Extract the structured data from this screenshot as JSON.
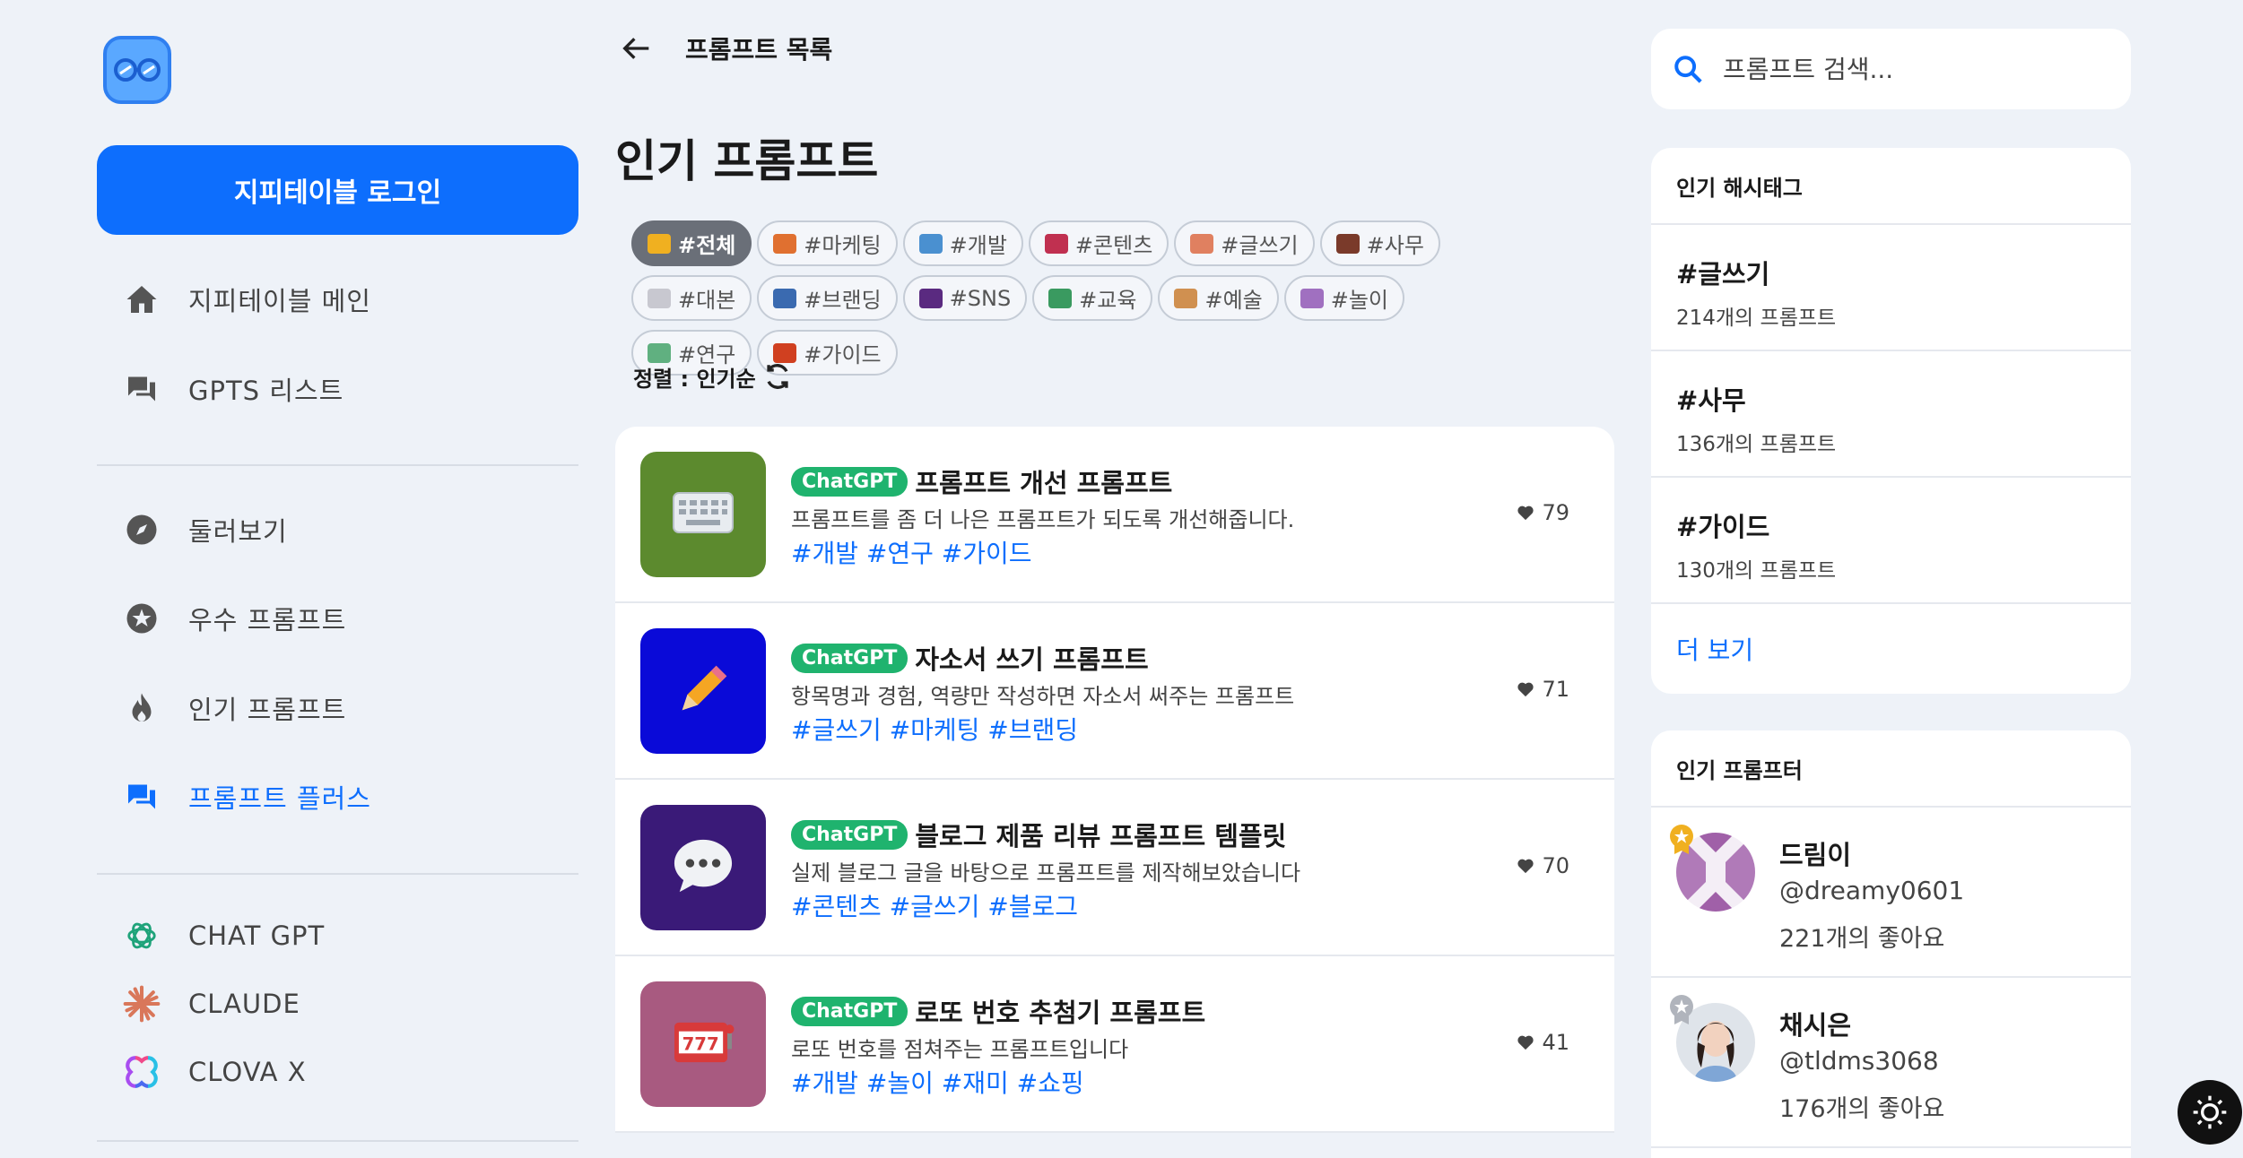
{
  "sidebar": {
    "login_label": "지피테이블 로그인",
    "nav_main": [
      {
        "label": "지피테이블 메인",
        "icon": "home-icon"
      },
      {
        "label": "GPTS 리스트",
        "icon": "chat-icon"
      }
    ],
    "nav_browse": [
      {
        "label": "둘러보기",
        "icon": "compass-icon"
      },
      {
        "label": "우수 프롬프트",
        "icon": "star-icon"
      },
      {
        "label": "인기 프롬프트",
        "icon": "fire-icon"
      },
      {
        "label": "프롬프트 플러스",
        "icon": "forum-icon",
        "active": true
      }
    ],
    "nav_ai": [
      {
        "label": "CHAT GPT",
        "icon": "openai-icon"
      },
      {
        "label": "CLAUDE",
        "icon": "claude-icon"
      },
      {
        "label": "CLOVA X",
        "icon": "clova-icon"
      }
    ]
  },
  "header": {
    "back_title": "프롬프트 목록",
    "page_title": "인기 프롬프트"
  },
  "tags": [
    {
      "label": "#전체",
      "active": true,
      "color": "#f0b020"
    },
    {
      "label": "#마케팅",
      "color": "#e07030"
    },
    {
      "label": "#개발",
      "color": "#4a90d0"
    },
    {
      "label": "#콘텐츠",
      "color": "#c03050"
    },
    {
      "label": "#글쓰기",
      "color": "#e08060"
    },
    {
      "label": "#사무",
      "color": "#7a3a2a"
    },
    {
      "label": "#대본",
      "color": "#c8c8d0"
    },
    {
      "label": "#브랜딩",
      "color": "#3a6ab0"
    },
    {
      "label": "#SNS",
      "color": "#5a2a80"
    },
    {
      "label": "#교육",
      "color": "#3a9a60"
    },
    {
      "label": "#예술",
      "color": "#d09050"
    },
    {
      "label": "#놀이",
      "color": "#a070c0"
    },
    {
      "label": "#연구",
      "color": "#60b080"
    },
    {
      "label": "#가이드",
      "color": "#d04020"
    }
  ],
  "sort": {
    "label": "정렬 : 인기순"
  },
  "prompts": [
    {
      "badge": "ChatGPT",
      "title": "프롬프트 개선 프롬프트",
      "desc": "프롬프트를 좀 더 나은 프롬프트가 되도록 개선해줍니다.",
      "hashes": "#개발 #연구 #가이드",
      "likes": "79",
      "thumb_bg": "#5c8a2e",
      "icon": "keyboard-icon"
    },
    {
      "badge": "ChatGPT",
      "title": "자소서 쓰기 프롬프트",
      "desc": "항목명과 경험, 역량만 작성하면 자소서 써주는 프롬프트",
      "hashes": "#글쓰기 #마케팅 #브랜딩",
      "likes": "71",
      "thumb_bg": "#0a0ad8",
      "icon": "pencil-icon"
    },
    {
      "badge": "ChatGPT",
      "title": "블로그 제품 리뷰 프롬프트 템플릿",
      "desc": "실제 블로그 글을 바탕으로 프롬프트를 제작해보았습니다",
      "hashes": "#콘텐츠 #글쓰기 #블로그",
      "likes": "70",
      "thumb_bg": "#3a1a78",
      "icon": "speech-bubble-icon"
    },
    {
      "badge": "ChatGPT",
      "title": "로또 번호 추첨기 프롬프트",
      "desc": "로또 번호를 점쳐주는 프롬프트입니다",
      "hashes": "#개발 #놀이 #재미 #쇼핑",
      "likes": "41",
      "thumb_bg": "#a85a80",
      "icon": "slot-machine-icon"
    }
  ],
  "search": {
    "placeholder": "프롬프트 검색..."
  },
  "hashtag_panel": {
    "title": "인기 해시태그",
    "items": [
      {
        "name": "#글쓰기",
        "count": "214개의 프롬프트"
      },
      {
        "name": "#사무",
        "count": "136개의 프롬프트"
      },
      {
        "name": "#가이드",
        "count": "130개의 프롬프트"
      }
    ],
    "more": "더 보기"
  },
  "prompter_panel": {
    "title": "인기 프롬프터",
    "users": [
      {
        "name": "드림이",
        "handle": "@dreamy0601",
        "likes": "221개의 좋아요",
        "rank_color": "#f0b020"
      },
      {
        "name": "채시은",
        "handle": "@tldms3068",
        "likes": "176개의 좋아요",
        "rank_color": "#b0b4bc"
      }
    ]
  }
}
